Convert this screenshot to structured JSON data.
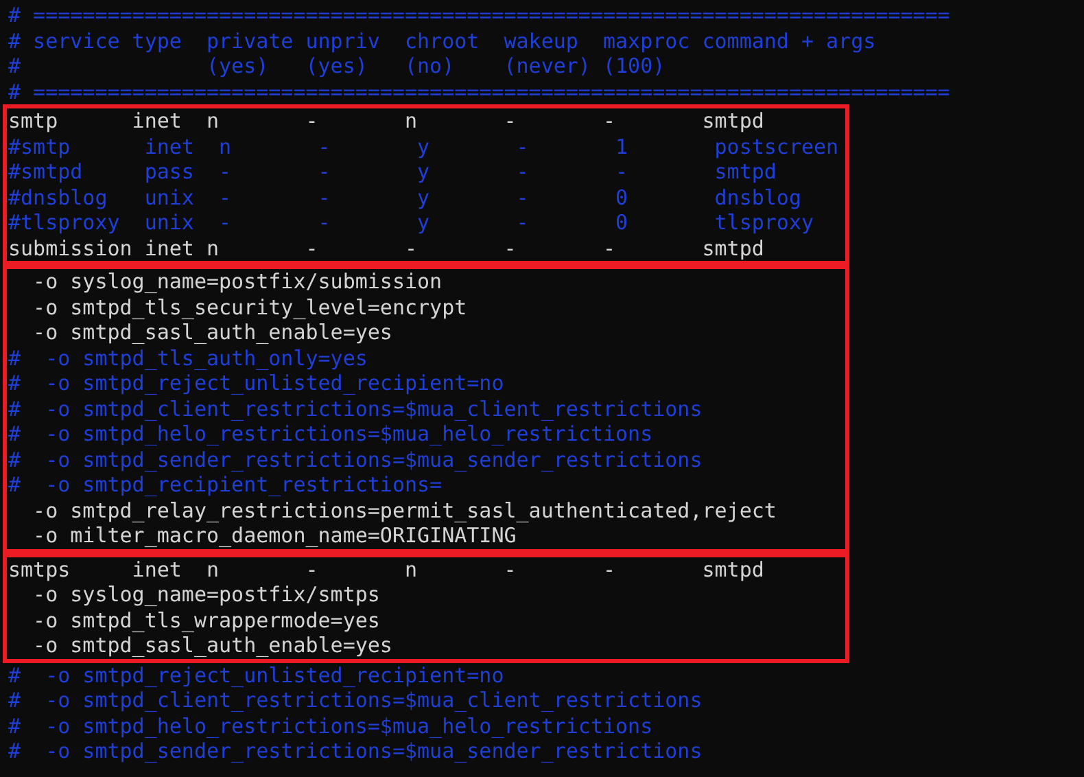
{
  "terminal": {
    "blocks": [
      {
        "highlighted": false,
        "lines": [
          {
            "kind": "comment",
            "text": "# =========================================================================="
          },
          {
            "kind": "comment",
            "text": "# service type  private unpriv  chroot  wakeup  maxproc command + args"
          },
          {
            "kind": "comment",
            "text": "#               (yes)   (yes)   (no)    (never) (100)"
          },
          {
            "kind": "comment",
            "text": "# =========================================================================="
          }
        ]
      },
      {
        "highlighted": true,
        "lines": [
          {
            "kind": "code",
            "text": "smtp      inet  n       -       n       -       -       smtpd"
          },
          {
            "kind": "comment",
            "text": "#smtp      inet  n       -       y       -       1       postscreen"
          },
          {
            "kind": "comment",
            "text": "#smtpd     pass  -       -       y       -       -       smtpd"
          },
          {
            "kind": "comment",
            "text": "#dnsblog   unix  -       -       y       -       0       dnsblog"
          },
          {
            "kind": "comment",
            "text": "#tlsproxy  unix  -       -       y       -       0       tlsproxy"
          },
          {
            "kind": "code",
            "text": "submission inet n       -       -       -       -       smtpd"
          }
        ]
      },
      {
        "highlighted": true,
        "lines": [
          {
            "kind": "code",
            "text": "  -o syslog_name=postfix/submission"
          },
          {
            "kind": "code",
            "text": "  -o smtpd_tls_security_level=encrypt"
          },
          {
            "kind": "code",
            "text": "  -o smtpd_sasl_auth_enable=yes"
          },
          {
            "kind": "comment",
            "text": "#  -o smtpd_tls_auth_only=yes"
          },
          {
            "kind": "comment",
            "text": "#  -o smtpd_reject_unlisted_recipient=no"
          },
          {
            "kind": "comment",
            "text": "#  -o smtpd_client_restrictions=$mua_client_restrictions"
          },
          {
            "kind": "comment",
            "text": "#  -o smtpd_helo_restrictions=$mua_helo_restrictions"
          },
          {
            "kind": "comment",
            "text": "#  -o smtpd_sender_restrictions=$mua_sender_restrictions"
          },
          {
            "kind": "comment",
            "text": "#  -o smtpd_recipient_restrictions="
          },
          {
            "kind": "code",
            "text": "  -o smtpd_relay_restrictions=permit_sasl_authenticated,reject"
          },
          {
            "kind": "code",
            "text": "  -o milter_macro_daemon_name=ORIGINATING"
          }
        ]
      },
      {
        "highlighted": true,
        "lines": [
          {
            "kind": "code",
            "text": "smtps     inet  n       -       n       -       -       smtpd"
          },
          {
            "kind": "code",
            "text": "  -o syslog_name=postfix/smtps"
          },
          {
            "kind": "code",
            "text": "  -o smtpd_tls_wrappermode=yes"
          },
          {
            "kind": "code",
            "text": "  -o smtpd_sasl_auth_enable=yes"
          }
        ]
      },
      {
        "highlighted": false,
        "lines": [
          {
            "kind": "comment",
            "text": "#  -o smtpd_reject_unlisted_recipient=no"
          },
          {
            "kind": "comment",
            "text": "#  -o smtpd_client_restrictions=$mua_client_restrictions"
          },
          {
            "kind": "comment",
            "text": "#  -o smtpd_helo_restrictions=$mua_helo_restrictions"
          },
          {
            "kind": "comment",
            "text": "#  -o smtpd_sender_restrictions=$mua_sender_restrictions"
          }
        ]
      }
    ]
  }
}
